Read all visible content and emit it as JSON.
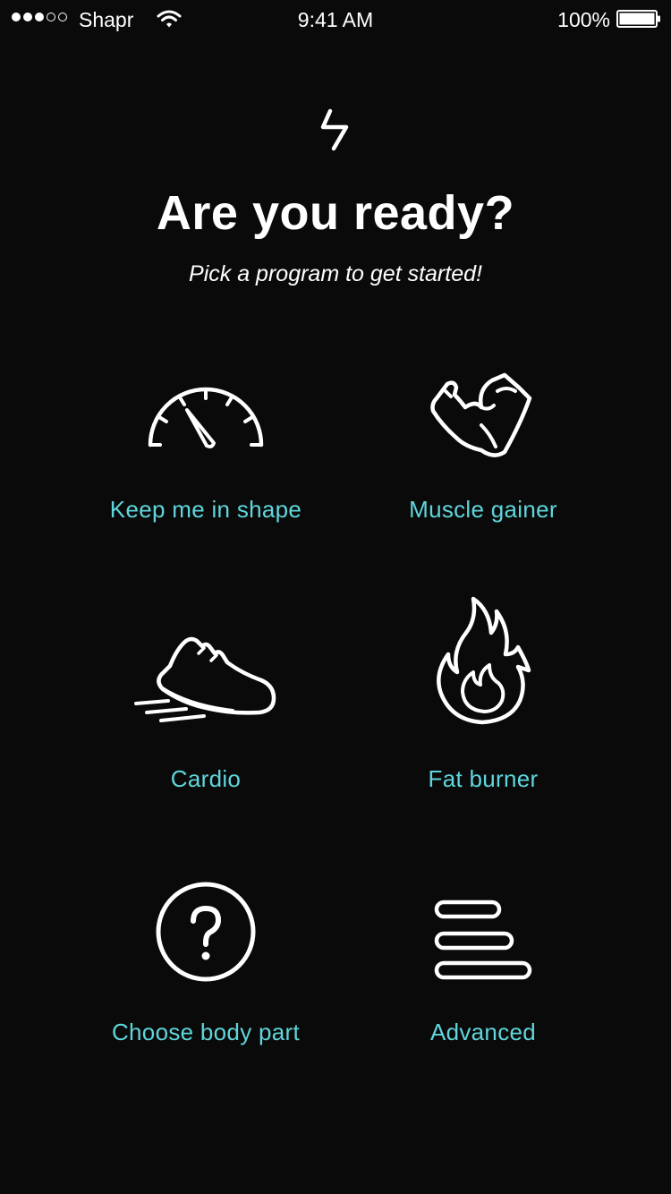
{
  "status_bar": {
    "carrier": "Shapr",
    "time": "9:41 AM",
    "battery": "100%"
  },
  "header": {
    "logo_icon": "lightning-bolt-icon",
    "title": "Are you ready?",
    "subtitle": "Pick a program to get started!"
  },
  "programs": [
    {
      "label": "Keep me in shape",
      "icon": "speedometer-icon"
    },
    {
      "label": "Muscle gainer",
      "icon": "flexed-arm-icon"
    },
    {
      "label": "Cardio",
      "icon": "running-shoe-icon"
    },
    {
      "label": "Fat burner",
      "icon": "flame-icon"
    },
    {
      "label": "Choose body part",
      "icon": "question-circle-icon"
    },
    {
      "label": "Advanced",
      "icon": "stacked-bars-icon"
    }
  ],
  "colors": {
    "background": "#0a0a0a",
    "accent": "#5fd6dc",
    "text": "#ffffff"
  }
}
